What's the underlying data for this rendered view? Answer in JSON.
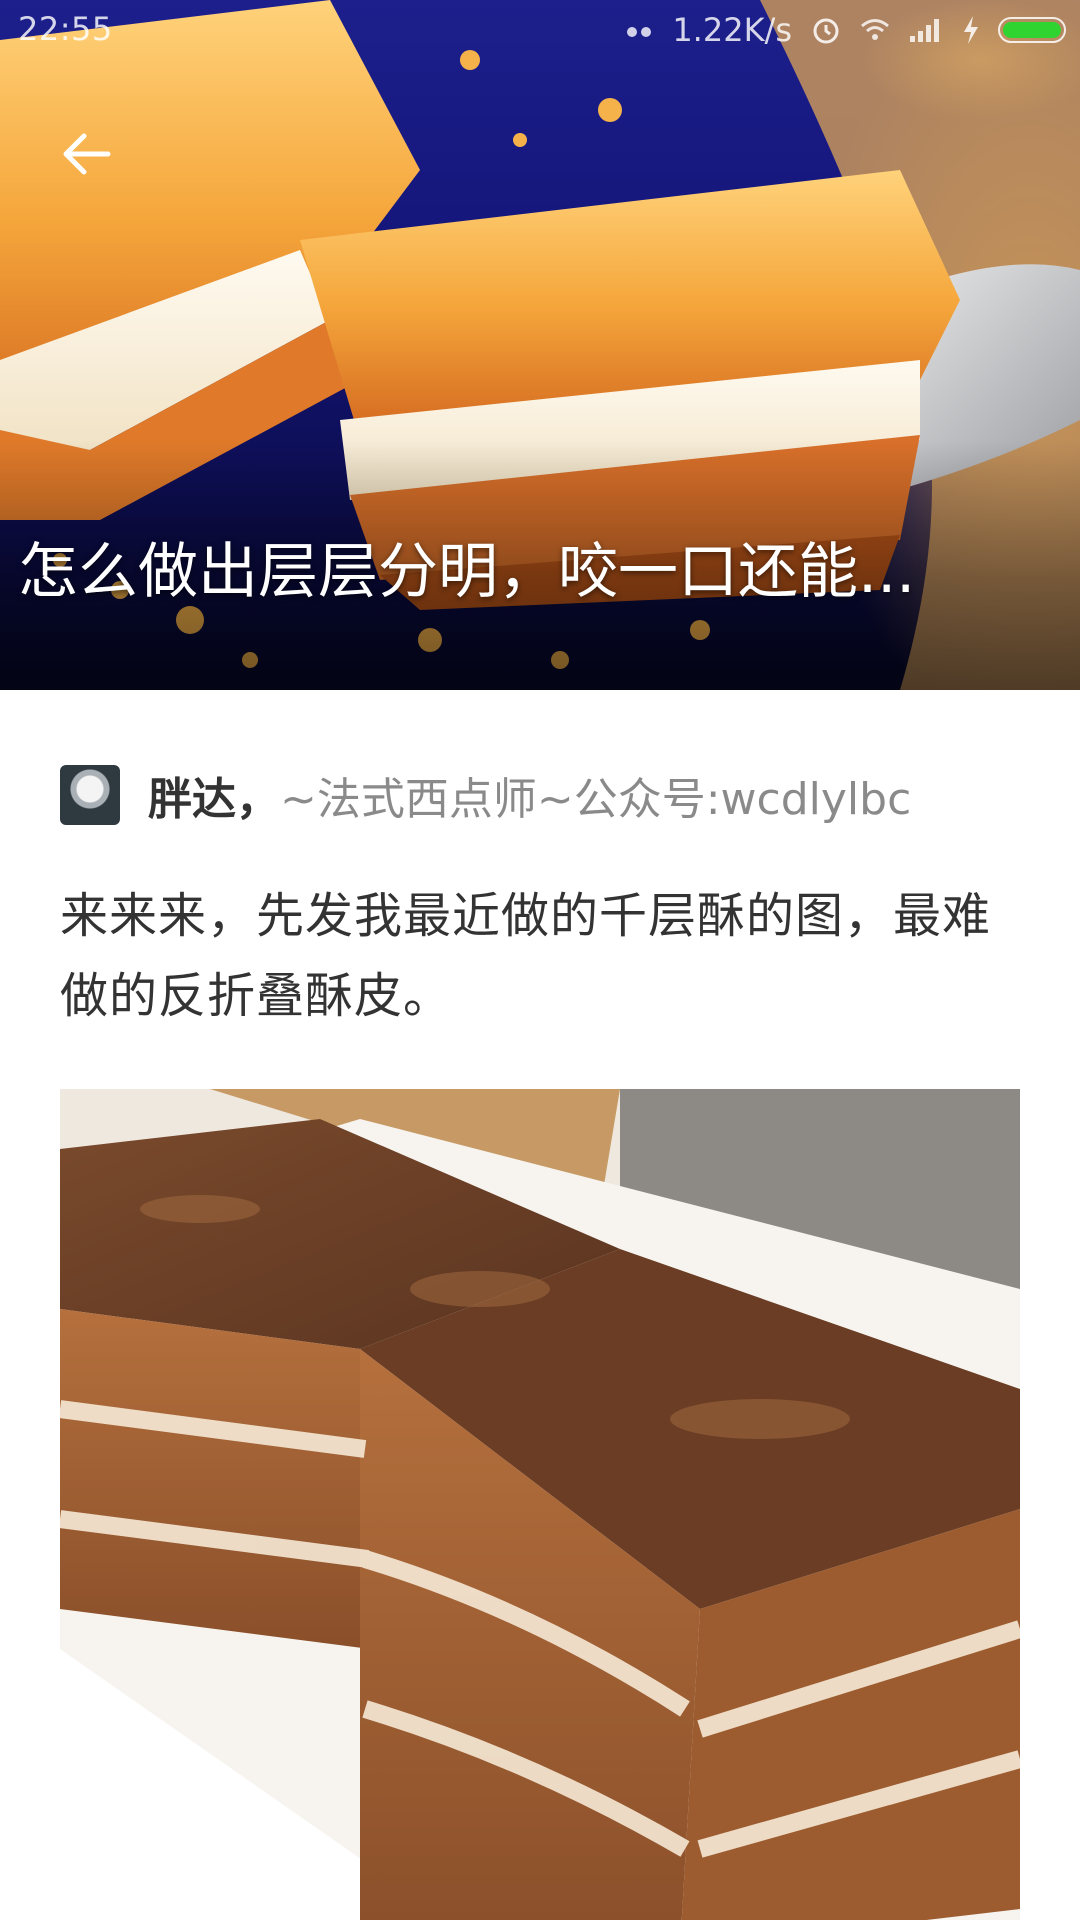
{
  "status_bar": {
    "time": "22:55",
    "network_speed": "1.22K/s",
    "icons": [
      "notification-dots-icon",
      "alarm-icon",
      "wifi-icon",
      "signal-icon",
      "charging-icon",
      "battery-icon"
    ],
    "battery_level": 1.0,
    "battery_color": "#2fd431"
  },
  "header": {
    "back_icon": "arrow-left-icon",
    "title": "怎么做出层层分明，咬一口还能..."
  },
  "answer": {
    "author_name": "胖达，",
    "author_bio": "~法式西点师~公众号:wcdlylbc",
    "text": "来来来，先发我最近做的千层酥的图，最难做的反折叠酥皮。"
  },
  "colors": {
    "hero_background": "#14167a",
    "text_primary": "#333333",
    "text_secondary": "#8a8a8a"
  }
}
